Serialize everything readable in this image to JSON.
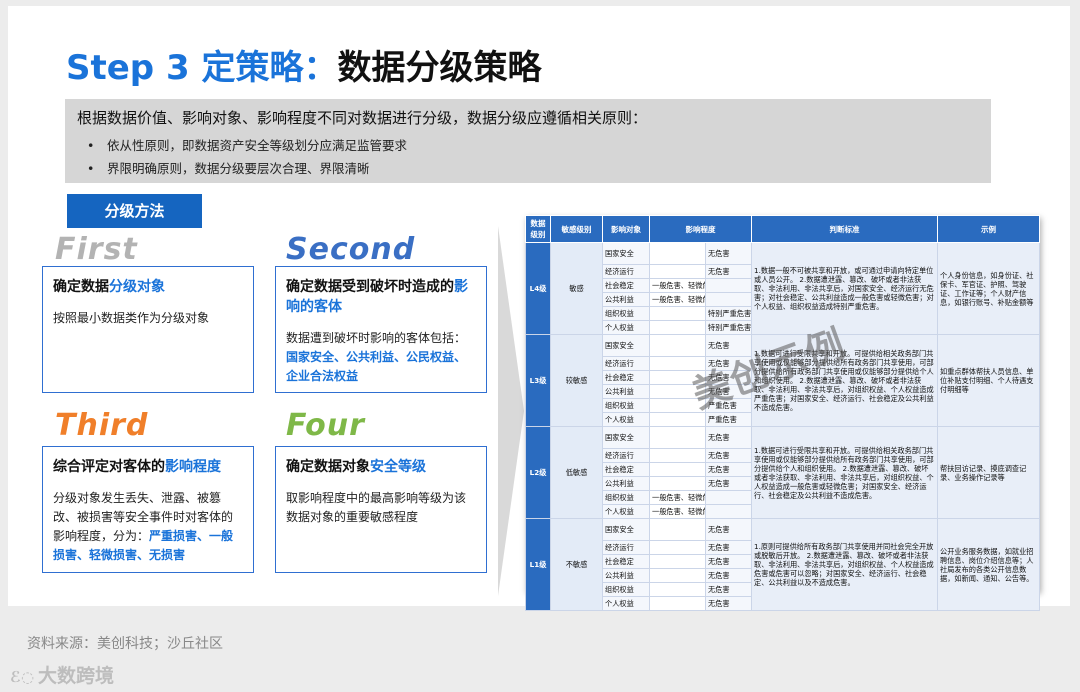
{
  "title": {
    "prefix": "Step 3 定策略：",
    "main": "数据分级策略"
  },
  "intro": {
    "lead": "根据数据价值、影响对象、影响程度不同对数据进行分级，数据分级应遵循相关原则：",
    "bullets": [
      "依从性原则，即数据资产安全等级划分应满足监管要求",
      "界限明确原则，数据分级要层次合理、界限清晰"
    ]
  },
  "method_label": "分级方法",
  "steps": {
    "first": {
      "word": "First",
      "head_a": "确定数据",
      "head_hl": "分级对象",
      "head_b": "",
      "body_a": "按照最小数据类作为分级对象",
      "body_hl": "",
      "body_b": ""
    },
    "second": {
      "word": "Second",
      "head_a": "确定数据受到破坏时造成的",
      "head_hl": "影响的客体",
      "head_b": "",
      "body_a": "数据遭到破坏时影响的客体包括：",
      "body_hl": "国家安全、公共利益、公民权益、企业合法权益",
      "body_b": ""
    },
    "third": {
      "word": "Third",
      "head_a": "综合评定对客体的",
      "head_hl": "影响程度",
      "head_b": "",
      "body_a": "分级对象发生丢失、泄露、被篡改、被损害等安全事件时对客体的影响程度，分为：",
      "body_hl": "严重损害、一般损害、轻微损害、无损害",
      "body_b": ""
    },
    "four": {
      "word": "Four",
      "head_a": "确定数据对象",
      "head_hl": "安全等级",
      "head_b": "",
      "body_a": "取影响程度中的最高影响等级为该数据对象的重要敏感程度",
      "body_hl": "",
      "body_b": ""
    }
  },
  "table": {
    "headers": [
      "数据级别",
      "敏感级别",
      "影响对象",
      "影响程度",
      "判断标准",
      "示例"
    ],
    "rows": [
      {
        "level": "L4级",
        "sensitivity": "敏感",
        "objects": [
          {
            "obj": "国家安全",
            "deg": "",
            "dmg": "无危害"
          },
          {
            "obj": "经济运行",
            "deg": "",
            "dmg": "无危害"
          },
          {
            "obj": "社会稳定",
            "deg": "一般危害、轻微危害",
            "dmg": ""
          },
          {
            "obj": "公共利益",
            "deg": "一般危害、轻微危害",
            "dmg": ""
          },
          {
            "obj": "组织权益",
            "deg": "",
            "dmg": "特别严重危害"
          },
          {
            "obj": "个人权益",
            "deg": "",
            "dmg": "特别严重危害"
          }
        ],
        "criteria": "1.数据一般不可被共享和开放，或可通过申请向特定单位或人员公开。 2.数据遭泄露、篡改、破坏或者非法获取、非法利用、非法共享后，对国家安全、经济运行无危害；对社会稳定、公共利益造成一般危害或轻微危害；对个人权益、组织权益造成特别严重危害。",
        "example": "个人身份信息，如身份证、社保卡、军官证、护照、驾驶证、工作证等；个人财产信息，如银行账号、补贴金额等"
      },
      {
        "level": "L3级",
        "sensitivity": "较敏感",
        "objects": [
          {
            "obj": "国家安全",
            "deg": "",
            "dmg": "无危害"
          },
          {
            "obj": "经济运行",
            "deg": "",
            "dmg": "无危害"
          },
          {
            "obj": "社会稳定",
            "deg": "",
            "dmg": "无危害"
          },
          {
            "obj": "公共利益",
            "deg": "",
            "dmg": "无危害"
          },
          {
            "obj": "组织权益",
            "deg": "",
            "dmg": "严重危害"
          },
          {
            "obj": "个人权益",
            "deg": "",
            "dmg": "严重危害"
          }
        ],
        "criteria": "1.数据可进行受限共享和开放。可提供给相关政务部门共享使用或仅能够部分提供给所有政务部门共享使用，可部分提供给所有政务部门共享使用或仅能够部分提供给个人和组织使用。 2.数据遭泄露、篡改、破坏或者非法获取、非法利用、非法共享后，对组织权益、个人权益造成严重危害；对国家安全、经济运行、社会稳定及公共利益不造成危害。",
        "example": "如重点群体帮扶人员信息、单位补贴支付明细、个人待遇支付明细等"
      },
      {
        "level": "L2级",
        "sensitivity": "低敏感",
        "objects": [
          {
            "obj": "国家安全",
            "deg": "",
            "dmg": "无危害"
          },
          {
            "obj": "经济运行",
            "deg": "",
            "dmg": "无危害"
          },
          {
            "obj": "社会稳定",
            "deg": "",
            "dmg": "无危害"
          },
          {
            "obj": "公共利益",
            "deg": "",
            "dmg": "无危害"
          },
          {
            "obj": "组织权益",
            "deg": "一般危害、轻微危害",
            "dmg": ""
          },
          {
            "obj": "个人权益",
            "deg": "一般危害、轻微危害",
            "dmg": ""
          }
        ],
        "criteria": "1.数据可进行受限共享和开放。可提供给相关政务部门共享使用或仅能够部分提供给所有政务部门共享使用，可部分提供给个人和组织使用。 2.数据遭泄露、篡改、破坏或者非法获取、非法利用、非法共享后，对组织权益、个人权益造成一般危害或轻微危害；对国家安全、经济运行、社会稳定及公共利益不造成危害。",
        "example": "帮扶回访记录、摸底调查记录、业务操作记录等"
      },
      {
        "level": "L1级",
        "sensitivity": "不敏感",
        "objects": [
          {
            "obj": "国家安全",
            "deg": "",
            "dmg": "无危害"
          },
          {
            "obj": "经济运行",
            "deg": "",
            "dmg": "无危害"
          },
          {
            "obj": "社会稳定",
            "deg": "",
            "dmg": "无危害"
          },
          {
            "obj": "公共利益",
            "deg": "",
            "dmg": "无危害"
          },
          {
            "obj": "组织权益",
            "deg": "",
            "dmg": "无危害"
          },
          {
            "obj": "个人权益",
            "deg": "",
            "dmg": "无危害"
          }
        ],
        "criteria": "1.原则可提供给所有政务部门共享使用并同社会完全开放或脱敏后开放。 2.数据遭泄露、篡改、破坏或者非法获取、非法利用、非法共享后，对组织权益、个人权益造成危害或危害可以忽略；对国家安全、经济运行、社会稳定、公共利益以及不造成危害。",
        "example": "公开业务服务数据，如就业招聘信息、岗位介绍信息等；人社局发布的各类公开信息数据，如新闻、通知、公告等。"
      }
    ]
  },
  "watermark": "美创示例",
  "source": "资料来源：美创科技；沙丘社区",
  "logo_text": "大数跨境"
}
